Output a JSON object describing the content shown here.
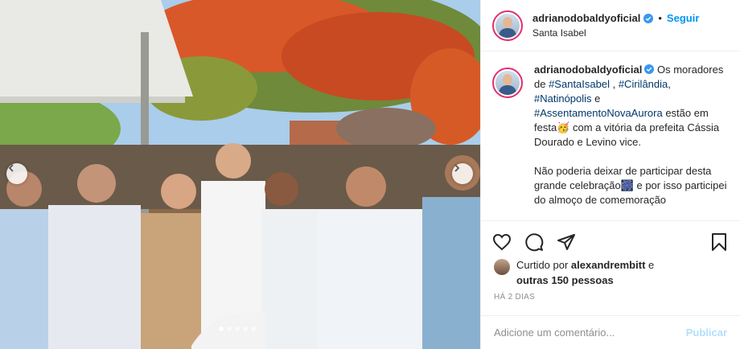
{
  "post": {
    "username": "adrianodobaldyoficial",
    "follow_label": "Seguir",
    "separator": "•",
    "location": "Santa Isabel",
    "photo_dots": 5,
    "active_dot": 0
  },
  "caption": {
    "username": "adrianodobaldyoficial",
    "t1": " Os moradores de ",
    "h1": "#SantaIsabel",
    "t2": " , ",
    "h2": "#Cirilândia",
    "t3": ", ",
    "h3": "#Natinópolis",
    "t4": " e ",
    "h4": "#AssentamentoNovaAurora",
    "t5": " estão em festa🥳 com a vitória da prefeita Cássia Dourado e Levino vice.",
    "para2": "Não poderia deixar de participar desta grande celebração🎆 e por isso participei do almoço de comemoração"
  },
  "likes": {
    "prefix": "Curtido por ",
    "user": "alexandrembitt",
    "middle": " e",
    "others": "outras 150 pessoas"
  },
  "time_ago": "HÁ 2 DIAS",
  "comment": {
    "placeholder": "Adicione um comentário...",
    "publish_label": "Publicar"
  },
  "icons": {
    "like": "heart-icon",
    "comment": "comment-icon",
    "share": "share-icon",
    "save": "bookmark-icon",
    "verified": "verified-badge-icon",
    "prev": "chevron-left-icon",
    "next": "chevron-right-icon"
  },
  "colors": {
    "link": "#00376b",
    "follow": "#0095f6",
    "verified": "#3897f0",
    "story_ring": "#e1306c"
  }
}
